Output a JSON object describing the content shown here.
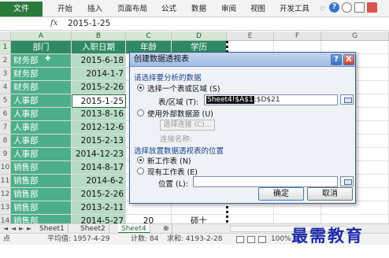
{
  "ribbon": {
    "file_tab": "文件",
    "menus": [
      "开始",
      "插入",
      "页面布局",
      "公式",
      "数据",
      "审阅",
      "视图",
      "开发工具"
    ]
  },
  "formula_bar": {
    "fx": "fx",
    "value": "2015-1-25"
  },
  "columns": [
    "A",
    "B",
    "C",
    "D",
    "E",
    "F",
    "G"
  ],
  "headers": [
    "部门",
    "入职日期",
    "年龄",
    "学历"
  ],
  "rows": [
    {
      "num": "2",
      "dept": "财务部",
      "date": "2015-6-18",
      "age": "",
      "edu": ""
    },
    {
      "num": "3",
      "dept": "财务部",
      "date": "2014-1-7",
      "age": "",
      "edu": ""
    },
    {
      "num": "4",
      "dept": "财务部",
      "date": "2015-2-26",
      "age": "",
      "edu": ""
    },
    {
      "num": "5",
      "dept": "人事部",
      "date": "2015-1-25",
      "age": "",
      "edu": ""
    },
    {
      "num": "6",
      "dept": "人事部",
      "date": "2013-8-16",
      "age": "",
      "edu": ""
    },
    {
      "num": "7",
      "dept": "人事部",
      "date": "2012-12-6",
      "age": "",
      "edu": ""
    },
    {
      "num": "8",
      "dept": "人事部",
      "date": "2015-2-13",
      "age": "",
      "edu": ""
    },
    {
      "num": "9",
      "dept": "人事部",
      "date": "2014-12-23",
      "age": "",
      "edu": ""
    },
    {
      "num": "10",
      "dept": "销售部",
      "date": "2014-8-17",
      "age": "",
      "edu": ""
    },
    {
      "num": "11",
      "dept": "销售部",
      "date": "2014-6-2",
      "age": "",
      "edu": ""
    },
    {
      "num": "12",
      "dept": "销售部",
      "date": "2015-2-26",
      "age": "",
      "edu": ""
    },
    {
      "num": "13",
      "dept": "销售部",
      "date": "2013-2-11",
      "age": "",
      "edu": ""
    },
    {
      "num": "14",
      "dept": "销售部",
      "date": "2014-5-27",
      "age": "20",
      "edu": "硕士"
    }
  ],
  "header_row_num": "1",
  "sheet_tabs": [
    "Sheet1",
    "Sheet2",
    "Sheet4"
  ],
  "status_bar": {
    "average": "平均值: 1957-4-29",
    "count": "计数: 84",
    "sum": "求和: 4193-2-28",
    "zoom": "100%"
  },
  "dialog": {
    "title": "创建数据透视表",
    "help": "?",
    "close": "X",
    "section_data": "请选择要分析的数据",
    "opt_select_table": "选择一个表或区域 (S)",
    "range_label": "表/区域 (T):",
    "range_value_hl": "Sheet4!$A$1",
    "range_value_rest": ":$D$21",
    "opt_external": "使用外部数据源 (U)",
    "choose_connection": "选择连接 (C)...",
    "connection_name_label": "连接名称:",
    "section_location": "选择放置数据透视表的位置",
    "opt_new_sheet": "新工作表 (N)",
    "opt_existing_sheet": "现有工作表 (E)",
    "location_label": "位置 (L):",
    "ok": "确定",
    "cancel": "取消"
  },
  "watermark": "最需教育"
}
